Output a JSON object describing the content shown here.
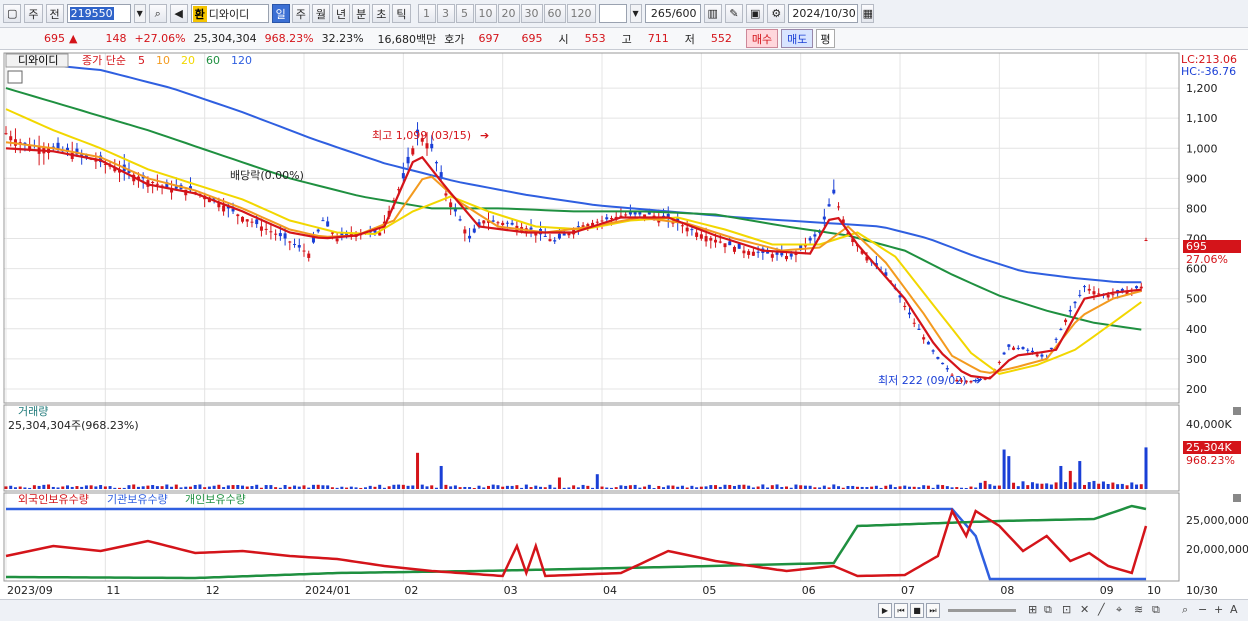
{
  "toolbar": {
    "period_type": "주",
    "prev_label": "전",
    "code": "219550",
    "hwan": "환",
    "stock_name": "디와이디",
    "tabs": [
      "일",
      "주",
      "월",
      "년",
      "분",
      "초",
      "틱"
    ],
    "active_tab": "일",
    "intervals": [
      "1",
      "3",
      "5",
      "10",
      "20",
      "30",
      "60",
      "120"
    ],
    "count_value": "265",
    "count_total": "/600",
    "date": "2024/10/30"
  },
  "quote": {
    "price": "695",
    "arrow": "▲",
    "change": "148",
    "change_pct": "+27.06%",
    "volume": "25,304,304",
    "volume_ratio": "968.23%",
    "turnover": "32.23%",
    "amount": "16,680백만",
    "hoga_label": "호가",
    "ask": "697",
    "bid": "695",
    "open_label": "시",
    "open": "553",
    "high_label": "고",
    "high": "711",
    "low_label": "저",
    "low": "552",
    "buy_label": "매수",
    "sell_label": "매도",
    "eval_label": "평"
  },
  "price_panel": {
    "name_tag": "디와이디",
    "legend_prefix": "종가 단순",
    "ma_periods": [
      "5",
      "10",
      "20",
      "60",
      "120"
    ],
    "ma_colors": [
      "#d4141a",
      "#f39a1f",
      "#f2d700",
      "#1f9040",
      "#2f5fe0"
    ],
    "lc_label": "LC:213.06",
    "hc_label": "HC:-36.76",
    "y_ticks": [
      "1,200",
      "1,100",
      "1,000",
      "900",
      "800",
      "700",
      "600",
      "500",
      "400",
      "300",
      "200"
    ],
    "current_price_tag": "695",
    "current_pct_tag": "27.06%",
    "annotation_high": "최고 1,099 (03/15)",
    "annotation_low": "최저 222 (09/02)",
    "annotation_dividend": "배당락(0.00%)"
  },
  "volume_panel": {
    "title": "거래량",
    "subtitle": "25,304,304주(968.23%)",
    "y_tick": "40,000K",
    "current_tag": "25,304K",
    "current_pct": "968.23%"
  },
  "holdings_panel": {
    "legend": [
      "외국인보유수량",
      "기관보유수량",
      "개인보유수량"
    ],
    "legend_colors": [
      "#d4141a",
      "#2f5fe0",
      "#1f9040"
    ],
    "y_ticks": [
      "25,000,000",
      "20,000,000"
    ]
  },
  "x_axis": {
    "labels": [
      "2023/09",
      "11",
      "12",
      "2024/01",
      "02",
      "03",
      "04",
      "05",
      "06",
      "07",
      "08",
      "09",
      "10"
    ],
    "right_label": "10/30"
  },
  "chart_data": {
    "type": "candlestick",
    "y_range": [
      160,
      1290
    ],
    "price_path": [
      [
        0,
        1050
      ],
      [
        4,
        1010
      ],
      [
        9,
        1000
      ],
      [
        14,
        985
      ],
      [
        19,
        960
      ],
      [
        24,
        930
      ],
      [
        29,
        900
      ],
      [
        34,
        870
      ],
      [
        39,
        860
      ],
      [
        44,
        830
      ],
      [
        49,
        780
      ],
      [
        54,
        740
      ],
      [
        59,
        700
      ],
      [
        64,
        650
      ],
      [
        67,
        760
      ],
      [
        70,
        700
      ],
      [
        74,
        720
      ],
      [
        79,
        720
      ],
      [
        84,
        900
      ],
      [
        87,
        1050
      ],
      [
        90,
        1000
      ],
      [
        93,
        850
      ],
      [
        96,
        760
      ],
      [
        98,
        700
      ],
      [
        101,
        760
      ],
      [
        106,
        750
      ],
      [
        111,
        730
      ],
      [
        116,
        690
      ],
      [
        121,
        740
      ],
      [
        126,
        760
      ],
      [
        131,
        780
      ],
      [
        136,
        780
      ],
      [
        141,
        760
      ],
      [
        146,
        720
      ],
      [
        151,
        690
      ],
      [
        156,
        660
      ],
      [
        161,
        650
      ],
      [
        166,
        640
      ],
      [
        172,
        720
      ],
      [
        175,
        850
      ],
      [
        178,
        720
      ],
      [
        182,
        640
      ],
      [
        187,
        560
      ],
      [
        192,
        420
      ],
      [
        197,
        300
      ],
      [
        201,
        230
      ],
      [
        205,
        225
      ],
      [
        208,
        240
      ],
      [
        212,
        340
      ],
      [
        216,
        330
      ],
      [
        220,
        300
      ],
      [
        224,
        430
      ],
      [
        228,
        540
      ],
      [
        232,
        510
      ],
      [
        236,
        520
      ],
      [
        240,
        540
      ],
      [
        241,
        695
      ]
    ],
    "ma5": [
      [
        0,
        1000
      ],
      [
        10,
        990
      ],
      [
        20,
        960
      ],
      [
        30,
        880
      ],
      [
        40,
        850
      ],
      [
        50,
        790
      ],
      [
        60,
        720
      ],
      [
        67,
        700
      ],
      [
        74,
        710
      ],
      [
        80,
        740
      ],
      [
        87,
        990
      ],
      [
        93,
        870
      ],
      [
        100,
        740
      ],
      [
        110,
        720
      ],
      [
        120,
        720
      ],
      [
        130,
        770
      ],
      [
        140,
        770
      ],
      [
        150,
        710
      ],
      [
        160,
        660
      ],
      [
        170,
        650
      ],
      [
        175,
        790
      ],
      [
        180,
        680
      ],
      [
        190,
        500
      ],
      [
        197,
        330
      ],
      [
        203,
        245
      ],
      [
        208,
        235
      ],
      [
        213,
        310
      ],
      [
        218,
        320
      ],
      [
        222,
        330
      ],
      [
        228,
        500
      ],
      [
        234,
        520
      ],
      [
        240,
        530
      ],
      [
        241,
        560
      ]
    ],
    "ma10": [
      [
        0,
        1020
      ],
      [
        10,
        1000
      ],
      [
        20,
        970
      ],
      [
        30,
        900
      ],
      [
        40,
        860
      ],
      [
        50,
        800
      ],
      [
        60,
        730
      ],
      [
        67,
        705
      ],
      [
        74,
        710
      ],
      [
        82,
        760
      ],
      [
        89,
        920
      ],
      [
        96,
        820
      ],
      [
        104,
        740
      ],
      [
        114,
        720
      ],
      [
        124,
        740
      ],
      [
        134,
        770
      ],
      [
        144,
        750
      ],
      [
        154,
        700
      ],
      [
        164,
        660
      ],
      [
        172,
        670
      ],
      [
        178,
        740
      ],
      [
        186,
        620
      ],
      [
        194,
        450
      ],
      [
        200,
        310
      ],
      [
        207,
        250
      ],
      [
        213,
        270
      ],
      [
        220,
        300
      ],
      [
        227,
        440
      ],
      [
        234,
        500
      ],
      [
        241,
        530
      ]
    ],
    "ma20": [
      [
        0,
        1130
      ],
      [
        10,
        1060
      ],
      [
        20,
        1000
      ],
      [
        30,
        930
      ],
      [
        40,
        880
      ],
      [
        50,
        830
      ],
      [
        60,
        760
      ],
      [
        70,
        720
      ],
      [
        78,
        715
      ],
      [
        86,
        790
      ],
      [
        94,
        840
      ],
      [
        102,
        790
      ],
      [
        112,
        740
      ],
      [
        122,
        730
      ],
      [
        132,
        760
      ],
      [
        142,
        770
      ],
      [
        152,
        730
      ],
      [
        162,
        680
      ],
      [
        172,
        680
      ],
      [
        180,
        720
      ],
      [
        188,
        640
      ],
      [
        196,
        480
      ],
      [
        204,
        320
      ],
      [
        210,
        250
      ],
      [
        218,
        280
      ],
      [
        226,
        330
      ],
      [
        234,
        420
      ],
      [
        241,
        500
      ]
    ],
    "ma60": [
      [
        0,
        1200
      ],
      [
        15,
        1130
      ],
      [
        30,
        1060
      ],
      [
        45,
        980
      ],
      [
        60,
        900
      ],
      [
        75,
        840
      ],
      [
        90,
        800
      ],
      [
        105,
        800
      ],
      [
        120,
        790
      ],
      [
        135,
        790
      ],
      [
        150,
        780
      ],
      [
        165,
        740
      ],
      [
        178,
        710
      ],
      [
        190,
        660
      ],
      [
        200,
        580
      ],
      [
        210,
        510
      ],
      [
        220,
        460
      ],
      [
        230,
        420
      ],
      [
        241,
        395
      ]
    ],
    "ma120": [
      [
        0,
        1290
      ],
      [
        20,
        1260
      ],
      [
        35,
        1200
      ],
      [
        50,
        1120
      ],
      [
        65,
        1030
      ],
      [
        80,
        950
      ],
      [
        95,
        890
      ],
      [
        110,
        845
      ],
      [
        125,
        810
      ],
      [
        140,
        790
      ],
      [
        155,
        770
      ],
      [
        170,
        755
      ],
      [
        185,
        740
      ],
      [
        195,
        700
      ],
      [
        205,
        640
      ],
      [
        215,
        590
      ],
      [
        225,
        570
      ],
      [
        235,
        555
      ],
      [
        241,
        555
      ]
    ],
    "x_positions": [
      0,
      21,
      42,
      63,
      84,
      105,
      126,
      147,
      168,
      189,
      210,
      231,
      241
    ],
    "volume_peaks": [
      [
        92,
        14
      ],
      [
        87,
        22
      ],
      [
        117,
        7
      ],
      [
        125,
        9
      ],
      [
        211,
        24
      ],
      [
        223,
        14
      ],
      [
        225,
        11
      ],
      [
        227,
        17
      ],
      [
        212,
        20
      ],
      [
        241,
        25.3
      ]
    ]
  }
}
